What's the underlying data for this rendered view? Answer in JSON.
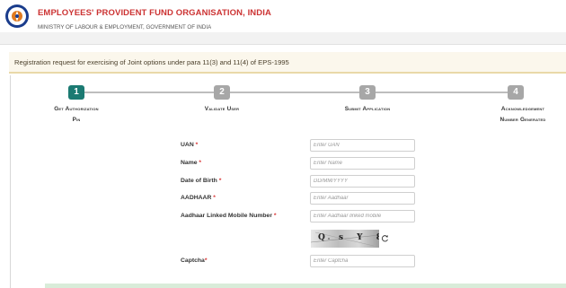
{
  "header": {
    "org_name": "EMPLOYEES' PROVIDENT FUND ORGANISATION, INDIA",
    "ministry": "MINISTRY OF LABOUR & EMPLOYMENT, GOVERNMENT OF INDIA"
  },
  "page": {
    "heading": "Registration request for exercising of Joint options under para 11(3) and 11(4) of EPS-1995"
  },
  "steps": [
    {
      "number": "1",
      "label_line1": "Get Authorization",
      "label_line2": "Pin",
      "active": true
    },
    {
      "number": "2",
      "label_line1": "Validate User",
      "label_line2": "",
      "active": false
    },
    {
      "number": "3",
      "label_line1": "Submit Application",
      "label_line2": "",
      "active": false
    },
    {
      "number": "4",
      "label_line1": "Acknowledgement",
      "label_line2": "Number Generated",
      "active": false
    }
  ],
  "form": {
    "uan": {
      "label": "UAN",
      "required": "*",
      "placeholder": "Enter UAN",
      "value": ""
    },
    "name": {
      "label": "Name",
      "required": "*",
      "placeholder": "Enter Name",
      "value": ""
    },
    "dob": {
      "label": "Date of Birth",
      "required": "*",
      "placeholder": "DD/MM/YYYY",
      "value": ""
    },
    "aadhaar": {
      "label": "AADHAAR",
      "required": "*",
      "placeholder": "Enter Aadhaar",
      "value": ""
    },
    "mobile": {
      "label": "Aadhaar Linked Mobile Number",
      "required": "*",
      "placeholder": "Enter Aadhaar linked mobile",
      "value": ""
    },
    "captcha": {
      "label": "Captcha",
      "required": "*",
      "placeholder": "Enter Captcha",
      "value": "",
      "image_text": "Q s Y 8"
    }
  },
  "colors": {
    "brand_red": "#cc3333",
    "active_step": "#1b7a72",
    "inactive_step": "#a7a7a7",
    "required_mark": "#d83030"
  },
  "icons": {
    "logo": "epfo-logo",
    "refresh": "refresh-icon"
  }
}
